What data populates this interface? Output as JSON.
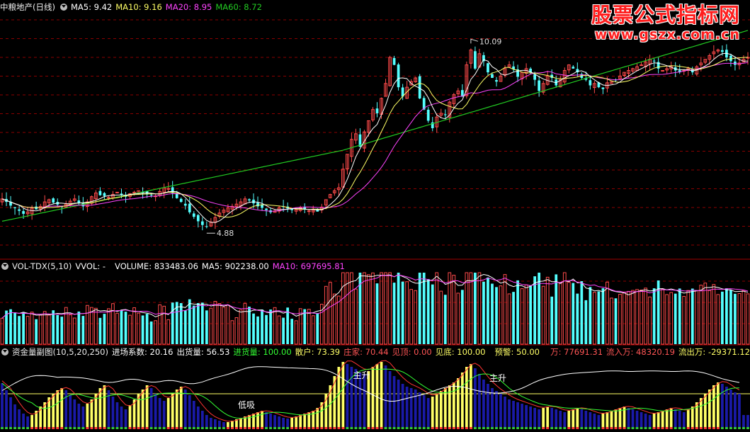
{
  "colors": {
    "up": "#ff4b4b",
    "down": "#54ffff",
    "ma5": "#ffffff",
    "ma10": "#ffff66",
    "ma20": "#ff44ff",
    "ma60": "#22cc22",
    "grid": "#8b0000",
    "background": "#000000"
  },
  "watermark": {
    "title": "股票公式指标网",
    "url": "www.gszx.com.cn"
  },
  "price_panel": {
    "name": "中粮地产(日线)",
    "ma5": "MA5: 9.42",
    "ma10": "MA10: 9.16",
    "ma20": "MA20: 8.95",
    "ma60": "MA60: 8.72",
    "high_label": "10.09",
    "low_label": "4.88"
  },
  "volume_panel": {
    "name": "VOL-TDX(5,10)",
    "vvol": "VVOL: -",
    "volume": "VOLUME: 833483.06",
    "ma5": "MA5: 902238.00",
    "ma10": "MA10: 697695.81"
  },
  "fund_panel": {
    "name": "资金量副图(10,5,20,250)",
    "jinchang": "进场系数: 20.16",
    "chuhuo": "出货量: 56.53",
    "jinhuo": "进货量: 100.00",
    "sanhu": "散户: 73.39",
    "zhuangjia": "庄家: 70.44",
    "jianding": "见顶: 0.00",
    "jiandi": "见底: 100.00",
    "yujing": "预警: 50.00",
    "wan": "万: 77691.31",
    "liuru": "流入万: 48320.19",
    "liuchu": "流出万: -29371.12",
    "annotations": [
      "低吸",
      "主升",
      "主升"
    ]
  },
  "chart_data": [
    {
      "type": "candlestick",
      "title": "中粮地产(日线)",
      "x": [
        1,
        2,
        3,
        4,
        5,
        6,
        7,
        8,
        9,
        10,
        11,
        12,
        13,
        14,
        15,
        16,
        17,
        18,
        19,
        20,
        21,
        22,
        23,
        24,
        25,
        26,
        27,
        28,
        29,
        30,
        31,
        32,
        33,
        34,
        35,
        36,
        37,
        38,
        39,
        40,
        41,
        42,
        43,
        44,
        45,
        46,
        47,
        48,
        49,
        50,
        51,
        52,
        53,
        54,
        55,
        56,
        57,
        58,
        59,
        60,
        61,
        62,
        63,
        64,
        65,
        66,
        67,
        68,
        69,
        70,
        71,
        72,
        73,
        74,
        75,
        76,
        77,
        78,
        79,
        80,
        81,
        82,
        83,
        84,
        85,
        86,
        87,
        88,
        89,
        90,
        91,
        92,
        93,
        94,
        95,
        96,
        97,
        98,
        99,
        100,
        101,
        102,
        103,
        104,
        105,
        106,
        107,
        108,
        109,
        110,
        111,
        112,
        113,
        114,
        115,
        116,
        117,
        118,
        119,
        120,
        121,
        122,
        123,
        124,
        125,
        126,
        127,
        128,
        129,
        130,
        131,
        132,
        133,
        134,
        135,
        136,
        137,
        138,
        139,
        140,
        141,
        142,
        143,
        144,
        145,
        146,
        147,
        148,
        149,
        150,
        151,
        152,
        153,
        154,
        155,
        156,
        157,
        158,
        159,
        160,
        161,
        162,
        163,
        164,
        165,
        166,
        167,
        168,
        169,
        170,
        171,
        172,
        173,
        174,
        175,
        176
      ],
      "close": [
        5.8,
        5.72,
        5.62,
        5.55,
        5.48,
        5.4,
        5.45,
        5.55,
        5.52,
        5.6,
        5.72,
        5.78,
        5.7,
        5.65,
        5.58,
        5.66,
        5.74,
        5.8,
        5.68,
        5.6,
        5.72,
        5.86,
        5.96,
        5.9,
        5.88,
        5.84,
        5.92,
        5.98,
        5.9,
        5.86,
        5.94,
        5.98,
        6.02,
        5.96,
        5.92,
        5.9,
        5.88,
        6.0,
        6.1,
        6.08,
        5.96,
        5.82,
        5.72,
        5.62,
        5.44,
        5.32,
        5.2,
        5.1,
        5.06,
        5.18,
        5.3,
        5.42,
        5.5,
        5.56,
        5.6,
        5.66,
        5.72,
        5.8,
        5.76,
        5.68,
        5.6,
        5.56,
        5.5,
        5.44,
        5.48,
        5.56,
        5.6,
        5.54,
        5.5,
        5.52,
        5.56,
        5.52,
        5.48,
        5.5,
        5.46,
        5.58,
        5.78,
        5.92,
        6.02,
        6.1,
        6.6,
        7.0,
        7.4,
        7.55,
        7.2,
        7.6,
        7.9,
        8.2,
        8.1,
        8.5,
        8.9,
        9.6,
        9.4,
        8.8,
        8.55,
        8.8,
        8.95,
        9.05,
        8.5,
        8.2,
        7.9,
        7.7,
        8.0,
        8.1,
        8.05,
        8.4,
        8.6,
        8.7,
        8.55,
        9.4,
        9.8,
        9.3,
        9.7,
        9.5,
        9.2,
        9.05,
        8.95,
        9.1,
        9.3,
        9.4,
        9.28,
        9.08,
        9.2,
        9.3,
        9.2,
        9.0,
        8.7,
        8.9,
        9.1,
        9.05,
        8.85,
        9.0,
        9.25,
        9.4,
        9.3,
        9.2,
        9.05,
        9.0,
        8.85,
        8.9,
        8.8,
        8.75,
        8.92,
        8.95,
        9.0,
        9.1,
        9.2,
        9.25,
        9.3,
        9.35,
        9.4,
        9.48,
        9.55,
        9.5,
        9.3,
        9.25,
        9.3,
        9.35,
        9.25,
        9.2,
        9.25,
        9.3,
        9.2,
        9.35,
        9.45,
        9.55,
        9.65,
        9.75,
        9.8,
        9.75,
        9.6,
        9.5,
        9.4,
        9.45,
        9.55,
        9.6
      ],
      "highlights": [
        {
          "label": "10.09",
          "value": 10.09
        },
        {
          "label": "4.88",
          "value": 4.88
        }
      ],
      "ylim": [
        4.2,
        10.8
      ],
      "grid": true
    },
    {
      "type": "bar",
      "title": "VOL-TDX(5,10)",
      "series": [
        {
          "name": "VOLUME"
        },
        {
          "name": "MA5"
        },
        {
          "name": "MA10"
        }
      ]
    },
    {
      "type": "bar",
      "title": "资金量副图(10,5,20,250)",
      "values": [
        0.65,
        0.55,
        0.45,
        0.35,
        0.28,
        0.22,
        0.18,
        0.2,
        0.26,
        0.32,
        0.38,
        0.45,
        0.5,
        0.55,
        0.58,
        0.55,
        0.48,
        0.42,
        0.36,
        0.32,
        0.36,
        0.42,
        0.5,
        0.58,
        0.62,
        0.55,
        0.46,
        0.38,
        0.32,
        0.28,
        0.34,
        0.42,
        0.5,
        0.56,
        0.62,
        0.58,
        0.5,
        0.44,
        0.4,
        0.44,
        0.5,
        0.56,
        0.6,
        0.56,
        0.48,
        0.4,
        0.32,
        0.26,
        0.2,
        0.16,
        0.14,
        0.12,
        0.1,
        0.1,
        0.12,
        0.14,
        0.16,
        0.18,
        0.2,
        0.22,
        0.24,
        0.26,
        0.24,
        0.22,
        0.2,
        0.18,
        0.16,
        0.15,
        0.16,
        0.18,
        0.2,
        0.22,
        0.24,
        0.26,
        0.3,
        0.38,
        0.5,
        0.62,
        0.75,
        0.88,
        0.95,
        0.92,
        0.88,
        0.85,
        0.8,
        0.78,
        0.82,
        0.88,
        0.92,
        0.95,
        0.9,
        0.82,
        0.75,
        0.7,
        0.64,
        0.6,
        0.58,
        0.56,
        0.52,
        0.48,
        0.44,
        0.46,
        0.5,
        0.54,
        0.58,
        0.62,
        0.66,
        0.72,
        0.8,
        0.88,
        0.92,
        0.86,
        0.78,
        0.7,
        0.64,
        0.58,
        0.54,
        0.5,
        0.46,
        0.42,
        0.4,
        0.38,
        0.36,
        0.34,
        0.32,
        0.3,
        0.28,
        0.3,
        0.32,
        0.3,
        0.28,
        0.26,
        0.24,
        0.26,
        0.28,
        0.3,
        0.28,
        0.26,
        0.24,
        0.22,
        0.2,
        0.22,
        0.24,
        0.26,
        0.28,
        0.3,
        0.32,
        0.3,
        0.28,
        0.26,
        0.24,
        0.22,
        0.2,
        0.22,
        0.24,
        0.26,
        0.28,
        0.3,
        0.28,
        0.26,
        0.24,
        0.28,
        0.32,
        0.38,
        0.44,
        0.5,
        0.56,
        0.62,
        0.66,
        0.64,
        0.6,
        0.56,
        0.52,
        0.5
      ],
      "ylim": [
        0,
        1
      ]
    }
  ]
}
